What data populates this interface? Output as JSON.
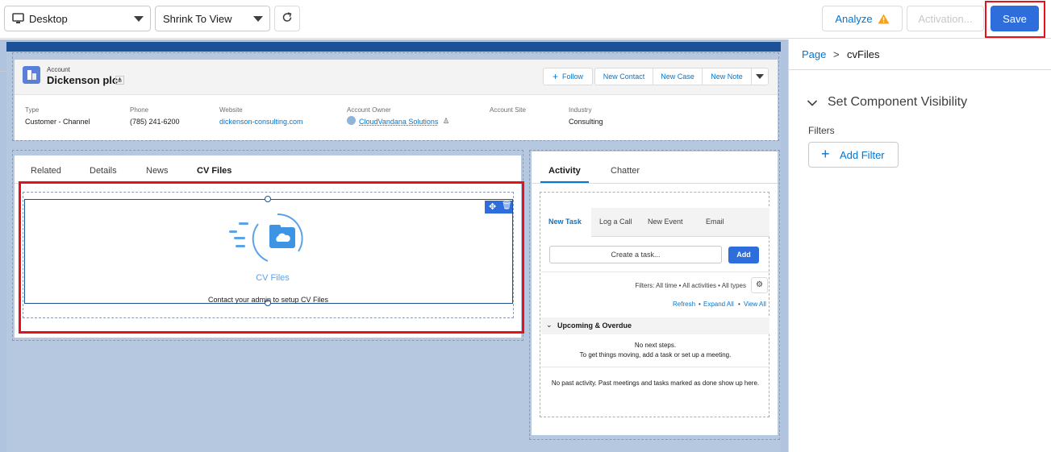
{
  "toolbar": {
    "device_label": "Desktop",
    "zoom_label": "Shrink To View",
    "analyze_label": "Analyze",
    "activation_label": "Activation...",
    "save_label": "Save"
  },
  "record": {
    "object_label": "Account",
    "name": "Dickenson plc",
    "actions": [
      "Follow",
      "New Contact",
      "New Case",
      "New Note"
    ],
    "fields": [
      {
        "label": "Type",
        "value": "Customer - Channel"
      },
      {
        "label": "Phone",
        "value": "(785) 241-6200"
      },
      {
        "label": "Website",
        "value": "dickenson-consulting.com"
      },
      {
        "label": "Account Owner",
        "value": "CloudVandana Solutions"
      },
      {
        "label": "Account Site",
        "value": ""
      },
      {
        "label": "Industry",
        "value": "Consulting"
      }
    ]
  },
  "tabs": [
    "Related",
    "Details",
    "News",
    "CV Files"
  ],
  "cv_component": {
    "title": "CV Files",
    "message": "Contact your admin to setup CV Files"
  },
  "activity": {
    "tabs": [
      "Activity",
      "Chatter"
    ],
    "subtabs": [
      "New Task",
      "Log a Call",
      "New Event",
      "Email"
    ],
    "task_placeholder": "Create a task...",
    "add_label": "Add",
    "filters_text": "Filters: All time • All activities • All types",
    "refresh": "Refresh",
    "expand_all": "Expand All",
    "view_all": "View All",
    "upcoming_title": "Upcoming & Overdue",
    "no_steps": "No next steps.",
    "no_steps_hint": "To get things moving, add a task or set up a meeting.",
    "no_past": "No past activity. Past meetings and tasks marked as done show up here."
  },
  "sidebar": {
    "breadcrumb_root": "Page",
    "breadcrumb_sep": ">",
    "breadcrumb_current": "cvFiles",
    "section_title": "Set Component Visibility",
    "filters_label": "Filters",
    "add_filter_label": "Add Filter"
  },
  "colors": {
    "brand": "#0176d3",
    "save_bg": "#2e6ddc",
    "highlight_red": "#e8101a",
    "warning": "#f4a21b"
  }
}
